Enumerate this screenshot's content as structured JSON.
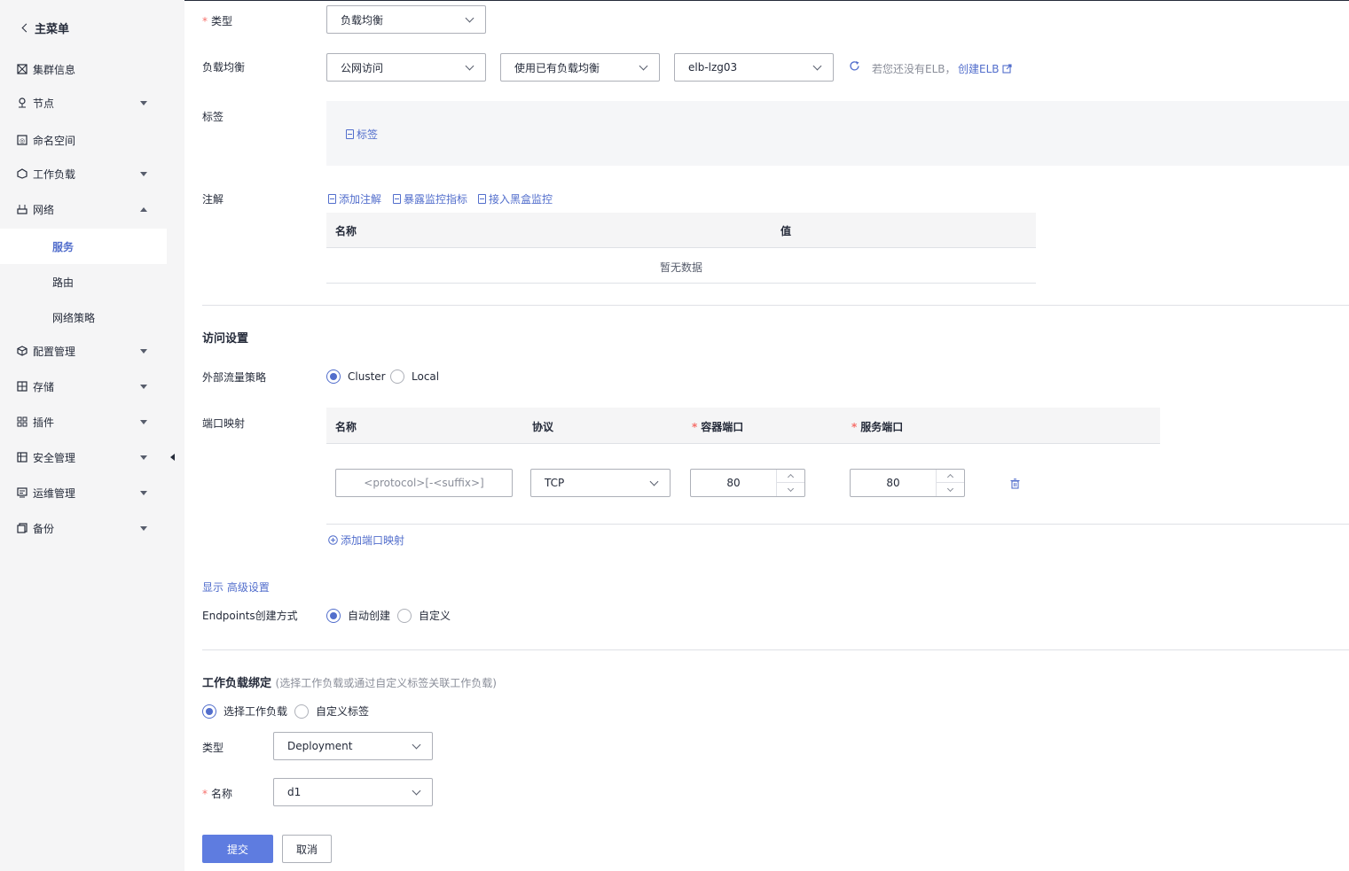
{
  "sidebar": {
    "back_label": "主菜单",
    "items": [
      {
        "label": "集群信息",
        "icon": "cluster-icon"
      },
      {
        "label": "节点",
        "icon": "node-icon"
      },
      {
        "label": "命名空间",
        "icon": "namespace-icon"
      },
      {
        "label": "工作负载",
        "icon": "workload-icon"
      },
      {
        "label": "网络",
        "icon": "network-icon"
      },
      {
        "label": "配置管理",
        "icon": "config-icon"
      },
      {
        "label": "存储",
        "icon": "storage-icon"
      },
      {
        "label": "插件",
        "icon": "plugin-icon"
      },
      {
        "label": "安全管理",
        "icon": "security-icon"
      },
      {
        "label": "运维管理",
        "icon": "ops-icon"
      },
      {
        "label": "备份",
        "icon": "backup-icon"
      }
    ],
    "network_sub": [
      "服务",
      "路由",
      "网络策略"
    ],
    "active_sub": "服务"
  },
  "form": {
    "type_label": "类型",
    "type_value": "负载均衡",
    "lb_label": "负载均衡",
    "lb_access": "公网访问",
    "lb_mode": "使用已有负载均衡",
    "lb_instance": "elb-lzg03",
    "lb_hint": "若您还没有ELB，",
    "lb_create": "创建ELB",
    "tags_label": "标签",
    "tags_link": "标签",
    "annotations_label": "注解",
    "annotation_links": [
      "添加注解",
      "暴露监控指标",
      "接入黑盒监控"
    ],
    "annotation_table": {
      "headers": [
        "名称",
        "值"
      ],
      "empty": "暂无数据"
    }
  },
  "access": {
    "title": "访问设置",
    "policy_label": "外部流量策略",
    "policy_options": [
      "Cluster",
      "Local"
    ],
    "policy_selected": "Cluster",
    "port_label": "端口映射",
    "port_headers": {
      "name": "名称",
      "protocol": "协议",
      "container_port": "容器端口",
      "service_port": "服务端口"
    },
    "port_row": {
      "name_placeholder": "<protocol>[-<suffix>]",
      "protocol": "TCP",
      "container_port": "80",
      "service_port": "80"
    },
    "add_port": "添加端口映射",
    "advanced_show": "显示",
    "advanced_label": "高级设置",
    "endpoints_label": "Endpoints创建方式",
    "endpoints_options": [
      "自动创建",
      "自定义"
    ],
    "endpoints_selected": "自动创建"
  },
  "binding": {
    "title": "工作负载绑定",
    "subtitle": "(选择工作负载或通过自定义标签关联工作负载)",
    "options": [
      "选择工作负载",
      "自定义标签"
    ],
    "selected": "选择工作负载",
    "type_label": "类型",
    "type_value": "Deployment",
    "name_label": "名称",
    "name_value": "d1"
  },
  "actions": {
    "submit": "提交",
    "cancel": "取消"
  },
  "colors": {
    "accent": "#526ecc",
    "primary_button": "#5e7ce0",
    "required": "#f66f6a"
  }
}
